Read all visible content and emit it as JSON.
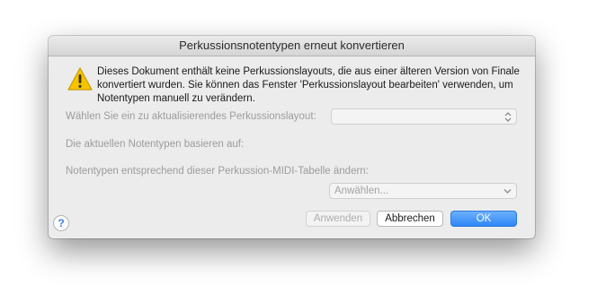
{
  "dialog": {
    "title": "Perkussionsnotentypen erneut konvertieren",
    "warning_icon": "warning-triangle-icon",
    "message": "Dieses Dokument enthält keine Perkussionslayouts, die aus einer älteren Version von Finale konvertiert wurden. Sie können das Fenster 'Perkussionslayout bearbeiten' verwenden, um Notentypen manuell zu verändern.",
    "layout_label": "Wählen Sie ein zu aktualisierendes Perkussionslayout:",
    "layout_select_value": "",
    "current_label": "Die aktuellen Notentypen basieren auf:",
    "midi_label": "Notentypen entsprechend dieser Perkussion-MIDI-Tabelle ändern:",
    "midi_select_value": "Anwählen...",
    "help_label": "?",
    "buttons": {
      "apply": "Anwenden",
      "cancel": "Abbrechen",
      "ok": "OK"
    },
    "colors": {
      "accent": "#2f86f7",
      "warning": "#f5c400",
      "disabled_text": "#9c9c9c"
    }
  }
}
